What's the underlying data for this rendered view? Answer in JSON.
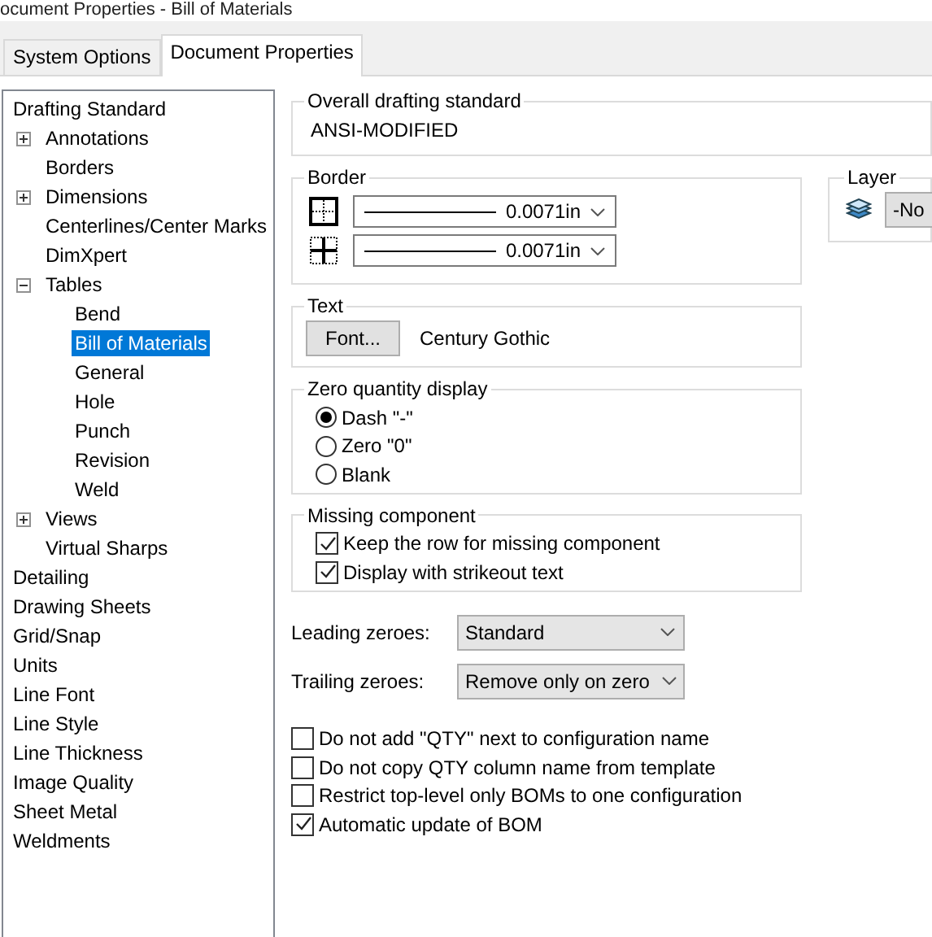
{
  "window": {
    "title": "ocument Properties - Bill of Materials"
  },
  "tabs": [
    {
      "label": "System Options",
      "selected": false
    },
    {
      "label": "Document Properties",
      "selected": true
    }
  ],
  "tree": [
    {
      "label": "Drafting Standard",
      "selected": false,
      "children": [
        {
          "label": "Annotations",
          "selected": false,
          "expanded": false
        },
        {
          "label": "Borders",
          "selected": false
        },
        {
          "label": "Dimensions",
          "selected": false,
          "expanded": false
        },
        {
          "label": "Centerlines/Center Marks",
          "selected": false
        },
        {
          "label": "DimXpert",
          "selected": false
        },
        {
          "label": "Tables",
          "selected": false,
          "expanded": true,
          "children": [
            {
              "label": "Bend",
              "selected": false
            },
            {
              "label": "Bill of Materials",
              "selected": true
            },
            {
              "label": "General",
              "selected": false
            },
            {
              "label": "Hole",
              "selected": false
            },
            {
              "label": "Punch",
              "selected": false
            },
            {
              "label": "Revision",
              "selected": false
            },
            {
              "label": "Weld",
              "selected": false
            }
          ]
        },
        {
          "label": "Views",
          "selected": false,
          "expanded": false
        },
        {
          "label": "Virtual Sharps",
          "selected": false
        }
      ]
    },
    {
      "label": "Detailing",
      "selected": false
    },
    {
      "label": "Drawing Sheets",
      "selected": false
    },
    {
      "label": "Grid/Snap",
      "selected": false
    },
    {
      "label": "Units",
      "selected": false
    },
    {
      "label": "Line Font",
      "selected": false
    },
    {
      "label": "Line Style",
      "selected": false
    },
    {
      "label": "Line Thickness",
      "selected": false
    },
    {
      "label": "Image Quality",
      "selected": false
    },
    {
      "label": "Sheet Metal",
      "selected": false
    },
    {
      "label": "Weldments",
      "selected": false
    }
  ],
  "overall_standard": {
    "title": "Overall drafting standard",
    "value": "ANSI-MODIFIED"
  },
  "border": {
    "title": "Border",
    "rows": [
      {
        "kind": "outer",
        "value": "0.0071in"
      },
      {
        "kind": "inner",
        "value": "0.0071in"
      }
    ]
  },
  "layer": {
    "title": "Layer",
    "value": "-No"
  },
  "text": {
    "title": "Text",
    "button": "Font...",
    "font": "Century Gothic"
  },
  "zero_quantity": {
    "title": "Zero quantity display",
    "options": [
      {
        "label": "Dash \"-\"",
        "selected": true
      },
      {
        "label": "Zero \"0\"",
        "selected": false
      },
      {
        "label": "Blank",
        "selected": false
      }
    ]
  },
  "missing_component": {
    "title": "Missing component",
    "options": [
      {
        "label": "Keep the row for missing component",
        "checked": true
      },
      {
        "label": "Display with strikeout text",
        "checked": true
      }
    ]
  },
  "dropdowns": [
    {
      "label": "Leading zeroes:",
      "value": "Standard"
    },
    {
      "label": "Trailing zeroes:",
      "value": "Remove only on zero"
    }
  ],
  "checkboxes": [
    {
      "label": "Do not add \"QTY\" next to configuration name",
      "checked": false
    },
    {
      "label": "Do not copy QTY column name from template",
      "checked": false
    },
    {
      "label": "Restrict top-level only BOMs to one configuration",
      "checked": false
    },
    {
      "label": "Automatic update of BOM",
      "checked": true
    }
  ]
}
